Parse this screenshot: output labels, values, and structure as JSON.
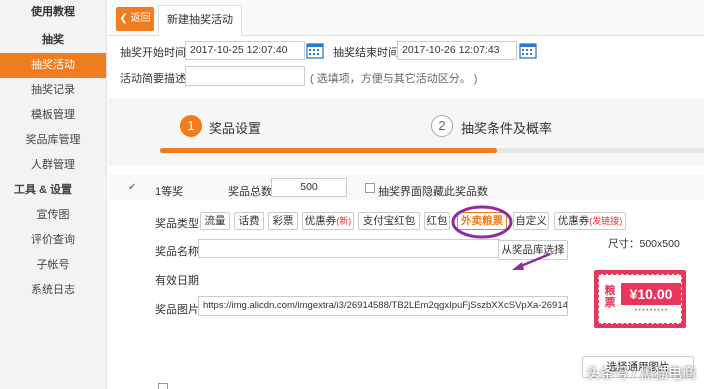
{
  "sidebar": {
    "items": [
      {
        "label": "使用教程",
        "type": "header"
      },
      {
        "label": "抽奖",
        "type": "header"
      },
      {
        "label": "抽奖活动",
        "type": "active"
      },
      {
        "label": "抽奖记录",
        "type": "item"
      },
      {
        "label": "模板管理",
        "type": "item"
      },
      {
        "label": "奖品库管理",
        "type": "item"
      },
      {
        "label": "人群管理",
        "type": "item"
      },
      {
        "label": "工具 & 设置",
        "type": "section"
      },
      {
        "label": "宣传图",
        "type": "item"
      },
      {
        "label": "评价查询",
        "type": "item"
      },
      {
        "label": "子帐号",
        "type": "item"
      },
      {
        "label": "系统日志",
        "type": "item"
      }
    ]
  },
  "tabbar": {
    "back_label": "返回",
    "tab_label": "新建抽奖活动"
  },
  "form": {
    "start_label": "抽奖开始时间",
    "start_value": "2017-10-25 12:07:40",
    "end_label": "抽奖结束时间",
    "end_value": "2017-10-26 12:07:43",
    "desc_label": "活动简要描述",
    "desc_hint": "( 选填项，方便与其它活动区分。 )"
  },
  "steps": [
    {
      "number": "1",
      "label": "奖品设置",
      "active": true
    },
    {
      "number": "2",
      "label": "抽奖条件及概率",
      "active": false
    }
  ],
  "progress": {
    "fraction": 0.62
  },
  "prize": {
    "level_label": "1等奖",
    "total_label": "奖品总数",
    "total_value": "500",
    "hide_label": "抽奖界面隐藏此奖品数",
    "type_label": "奖品类型",
    "types": [
      {
        "label": "流量",
        "tag": ""
      },
      {
        "label": "话费",
        "tag": ""
      },
      {
        "label": "彩票",
        "tag": ""
      },
      {
        "label": "优惠券",
        "tag": "(新)"
      },
      {
        "label": "支付宝红包",
        "tag": ""
      },
      {
        "label": "红包",
        "tag": ""
      },
      {
        "label": "外卖粮票",
        "tag": ""
      },
      {
        "label": "自定义",
        "tag": ""
      },
      {
        "label": "优惠券",
        "tag": "(发链接)"
      }
    ],
    "name_label": "奖品名称",
    "from_library_btn": "从奖品库选择",
    "size_text": "尺寸：500x500",
    "valid_label": "有效日期",
    "image_label": "奖品图片",
    "image_url": "https://img.alicdn.com/imgextra/i3/26914588/TB2LEm2qgxIpuFjSszbXXcSVpXa-26914588.gif",
    "choose_generic_btn": "选择通用图片"
  },
  "coupon": {
    "left_text": "粮票",
    "amount": "¥10.00"
  },
  "watermark": "头条号 / 黑猫电商",
  "colors": {
    "accent": "#f07d1f",
    "highlight_circle": "#8e2ca0",
    "coupon": "#e8365a"
  }
}
